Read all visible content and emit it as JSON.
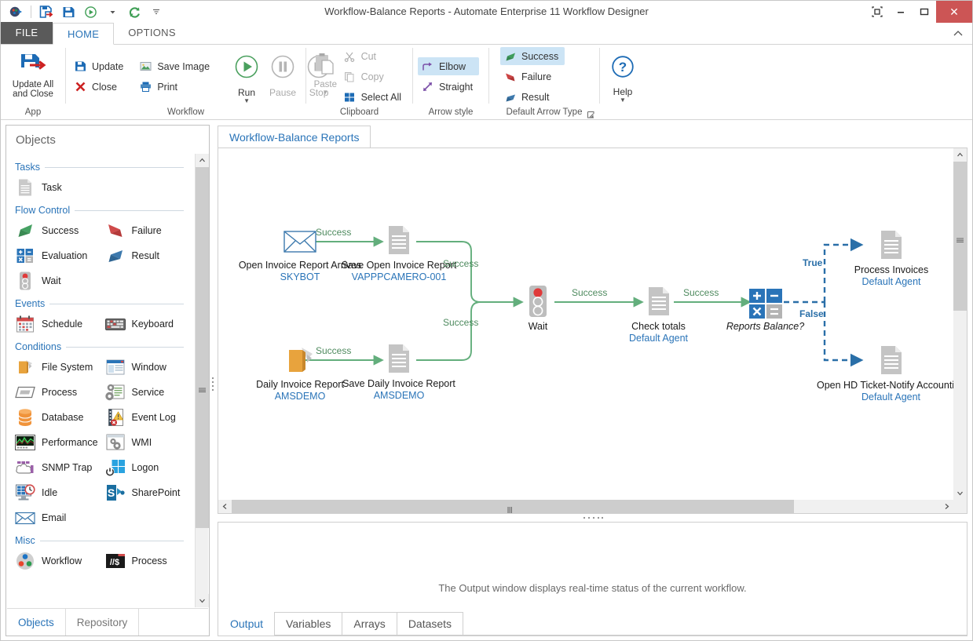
{
  "window": {
    "title": "Workflow-Balance Reports - Automate Enterprise 11 Workflow Designer",
    "restore_label": "Restore Down",
    "minimize_label": "Minimize",
    "maximize_label": "Maximize",
    "close_label": "✕"
  },
  "quick_access": [
    {
      "name": "app-menu-icon",
      "label": "Automate"
    },
    {
      "name": "update-close-icon",
      "label": "Update and Close"
    },
    {
      "name": "save-icon",
      "label": "Save"
    },
    {
      "name": "run-icon",
      "label": "Run"
    },
    {
      "name": "run-dropdown-icon",
      "label": "Run options"
    },
    {
      "name": "refresh-icon",
      "label": "Refresh"
    },
    {
      "name": "customize-qat-icon",
      "label": "Customize Quick Access Toolbar"
    }
  ],
  "ribbon": {
    "tabs": [
      {
        "label": "FILE",
        "active": false
      },
      {
        "label": "HOME",
        "active": true
      },
      {
        "label": "OPTIONS",
        "active": false
      }
    ],
    "groups": [
      {
        "label": "App",
        "big": {
          "label_line1": "Update All",
          "label_line2": "and Close",
          "icon": "update-all-and-close-icon"
        }
      },
      {
        "label": "Workflow",
        "small_left": [
          {
            "label": "Update",
            "icon": "save-icon",
            "disabled": false
          },
          {
            "label": "Close",
            "icon": "close-x-icon",
            "disabled": false
          }
        ],
        "small_right": [
          {
            "label": "Save Image",
            "icon": "image-icon",
            "disabled": false
          },
          {
            "label": "Print",
            "icon": "printer-icon",
            "disabled": false
          }
        ],
        "circles": [
          {
            "label": "Run",
            "icon": "play-icon",
            "disabled": false,
            "has_caret": true
          },
          {
            "label": "Pause",
            "icon": "pause-icon",
            "disabled": true,
            "has_caret": false
          },
          {
            "label": "Stop",
            "icon": "stop-icon",
            "disabled": true,
            "has_caret": false
          }
        ]
      },
      {
        "label": "Clipboard",
        "big": {
          "label_line1": "Paste",
          "label_line2": "",
          "icon": "paste-icon",
          "disabled": true,
          "has_caret": true
        },
        "small": [
          {
            "label": "Cut",
            "icon": "scissors-icon",
            "disabled": true
          },
          {
            "label": "Copy",
            "icon": "copy-icon",
            "disabled": true
          },
          {
            "label": "Select All",
            "icon": "select-all-icon",
            "disabled": false
          }
        ]
      },
      {
        "label": "Arrow style",
        "small": [
          {
            "label": "Elbow",
            "icon": "elbow-arrow-icon",
            "selected": true
          },
          {
            "label": "Straight",
            "icon": "straight-arrow-icon",
            "selected": false
          }
        ]
      },
      {
        "label": "Default Arrow Type",
        "small": [
          {
            "label": "Success",
            "icon": "success-arrow-icon",
            "selected": true
          },
          {
            "label": "Failure",
            "icon": "failure-arrow-icon",
            "selected": false
          },
          {
            "label": "Result",
            "icon": "result-arrow-icon",
            "selected": false
          }
        ]
      },
      {
        "label": "",
        "help": {
          "label": "Help",
          "icon": "help-icon",
          "has_caret": true
        }
      }
    ]
  },
  "objects_panel": {
    "title": "Objects",
    "categories": [
      {
        "label": "Tasks",
        "items": [
          {
            "label": "Task",
            "icon": "task-document-icon"
          }
        ]
      },
      {
        "label": "Flow Control",
        "items": [
          {
            "label": "Success",
            "icon": "success-arrow-icon"
          },
          {
            "label": "Failure",
            "icon": "failure-arrow-icon"
          },
          {
            "label": "Evaluation",
            "icon": "evaluation-icon"
          },
          {
            "label": "Result",
            "icon": "result-arrow-icon"
          },
          {
            "label": "Wait",
            "icon": "wait-traffic-light-icon"
          }
        ]
      },
      {
        "label": "Events",
        "items": [
          {
            "label": "Schedule",
            "icon": "calendar-icon"
          },
          {
            "label": "Keyboard",
            "icon": "keyboard-icon"
          }
        ]
      },
      {
        "label": "Conditions",
        "items": [
          {
            "label": "File System",
            "icon": "folder-icon"
          },
          {
            "label": "Window",
            "icon": "window-icon"
          },
          {
            "label": "Process",
            "icon": "process-icon"
          },
          {
            "label": "Service",
            "icon": "service-gear-icon"
          },
          {
            "label": "Database",
            "icon": "database-cylinder-icon"
          },
          {
            "label": "Event Log",
            "icon": "event-log-icon"
          },
          {
            "label": "Performance",
            "icon": "performance-graph-icon"
          },
          {
            "label": "WMI",
            "icon": "wmi-gear-icon"
          },
          {
            "label": "SNMP Trap",
            "icon": "snmp-cloud-icon"
          },
          {
            "label": "Logon",
            "icon": "windows-logon-icon"
          },
          {
            "label": "Idle",
            "icon": "idle-clock-icon"
          },
          {
            "label": "SharePoint",
            "icon": "sharepoint-icon"
          },
          {
            "label": "Email",
            "icon": "email-envelope-icon"
          }
        ]
      },
      {
        "label": "Misc",
        "items": [
          {
            "label": "Workflow",
            "icon": "workflow-circles-icon"
          },
          {
            "label": "Process",
            "icon": "script-process-icon"
          }
        ]
      }
    ],
    "tabs": [
      {
        "label": "Objects",
        "active": true
      },
      {
        "label": "Repository",
        "active": false
      }
    ]
  },
  "canvas": {
    "document_tab": "Workflow-Balance Reports",
    "nodes": [
      {
        "id": "open-invoice-report-arrives",
        "name": "Open Invoice Report Arrives",
        "agent": "SKYBOT",
        "icon": "email-envelope-icon"
      },
      {
        "id": "save-open-invoice-report",
        "name": "Save Open Invoice Report",
        "agent": "VAPPPCAMERO-001",
        "icon": "task-document-icon"
      },
      {
        "id": "daily-invoice-report",
        "name": "Daily Invoice Report",
        "agent": "AMSDEMO",
        "icon": "folder-icon"
      },
      {
        "id": "save-daily-invoice-report",
        "name": "Save Daily Invoice Report",
        "agent": "AMSDEMO",
        "icon": "task-document-icon"
      },
      {
        "id": "wait",
        "name": "Wait",
        "agent": "",
        "icon": "wait-traffic-light-icon"
      },
      {
        "id": "check-totals",
        "name": "Check totals",
        "agent": "Default Agent",
        "icon": "task-document-icon"
      },
      {
        "id": "reports-balance",
        "name": "Reports Balance?",
        "agent": "",
        "icon": "evaluation-icon",
        "italic": true
      },
      {
        "id": "process-invoices",
        "name": "Process Invoices",
        "agent": "Default Agent",
        "icon": "task-document-icon"
      },
      {
        "id": "open-hd-ticket-notify-accounting",
        "name": "Open HD Ticket-Notify Accounting",
        "agent": "Default Agent",
        "icon": "task-document-icon"
      }
    ],
    "edge_labels": [
      {
        "id": "edge-1",
        "text": "Success",
        "type": "success"
      },
      {
        "id": "edge-2",
        "text": "Success",
        "type": "success"
      },
      {
        "id": "edge-3",
        "text": "Success",
        "type": "success"
      },
      {
        "id": "edge-4",
        "text": "Success",
        "type": "success"
      },
      {
        "id": "edge-5",
        "text": "Success",
        "type": "success"
      },
      {
        "id": "edge-6",
        "text": "Success",
        "type": "success"
      },
      {
        "id": "edge-true",
        "text": "True",
        "type": "result"
      },
      {
        "id": "edge-false",
        "text": "False",
        "type": "result"
      }
    ]
  },
  "output_panel": {
    "message": "The Output window displays real-time status of the current workflow.",
    "tabs": [
      {
        "label": "Output",
        "active": true
      },
      {
        "label": "Variables",
        "active": false
      },
      {
        "label": "Arrays",
        "active": false
      },
      {
        "label": "Datasets",
        "active": false
      }
    ]
  },
  "colors": {
    "accent_blue": "#2a74b8",
    "success_green": "#5aa96f",
    "failure_red": "#c0392b",
    "result_blue": "#2a6fa8",
    "close_red": "#cc5555",
    "folder_orange": "#e8a33d"
  }
}
